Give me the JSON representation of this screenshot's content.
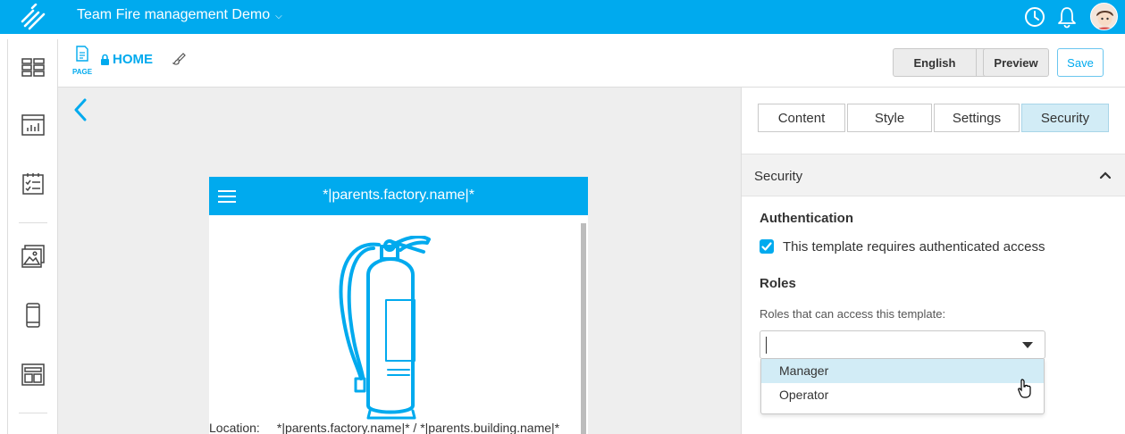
{
  "topbar": {
    "app_title": "Team Fire management Demo",
    "icons": [
      "logo-icon",
      "history-clock-icon",
      "bell-icon",
      "user-avatar"
    ]
  },
  "leftnav": {
    "icons": [
      "dashboard-icon",
      "reports-icon",
      "checklist-icon",
      "gallery-icon",
      "mobile-icon",
      "layout-icon"
    ]
  },
  "toolbar": {
    "page_type": "PAGE",
    "page_name": "HOME",
    "language": "English",
    "preview_label": "Preview",
    "save_label": "Save"
  },
  "canvas": {
    "header_title": "*|parents.factory.name|*",
    "location_key": "Location:",
    "location_value": "*|parents.factory.name|* / *|parents.building.name|*"
  },
  "side": {
    "tabs": [
      {
        "label": "Content",
        "active": false
      },
      {
        "label": "Style",
        "active": false
      },
      {
        "label": "Settings",
        "active": false
      },
      {
        "label": "Security",
        "active": true
      }
    ],
    "section_title": "Security",
    "auth_heading": "Authentication",
    "auth_checkbox_label": "This template requires authenticated access",
    "auth_checked": true,
    "roles_heading": "Roles",
    "roles_label": "Roles that can access this template:",
    "roles_input_value": "",
    "roles_options": [
      "Manager",
      "Operator"
    ],
    "highlighted_option": "Manager"
  },
  "colors": {
    "brand": "#00aaee",
    "active_tab": "#d2ecf6",
    "canvas_bg": "#eeeeee"
  }
}
